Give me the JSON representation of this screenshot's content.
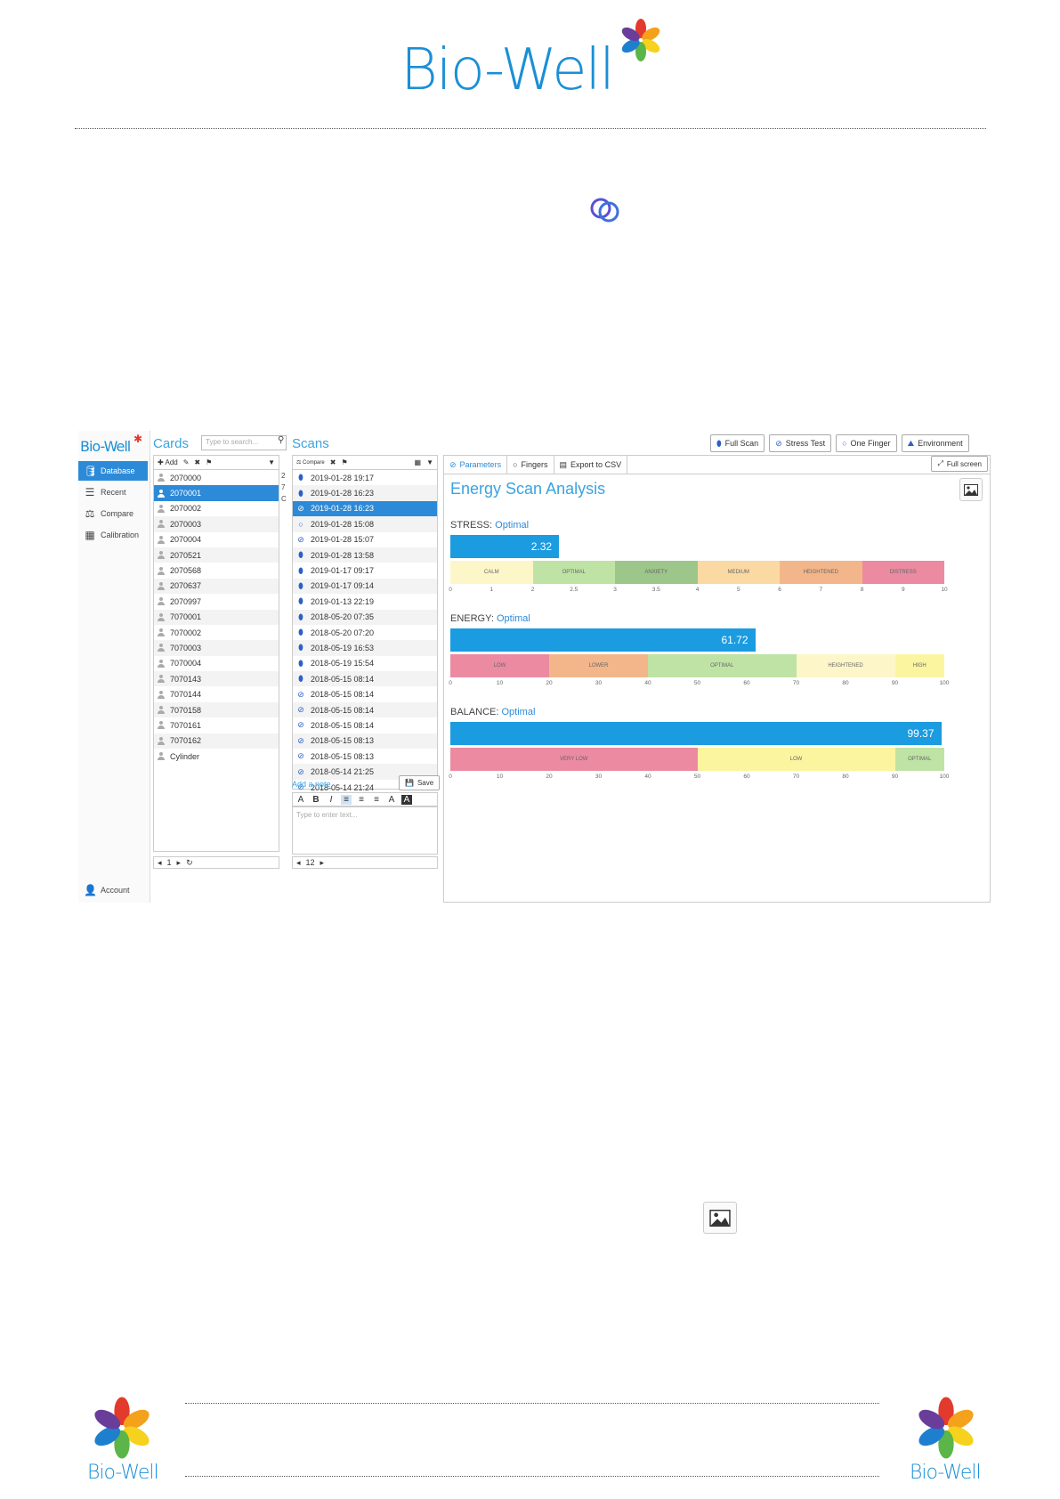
{
  "header": {
    "logo_text": "Bio-Well"
  },
  "footer": {
    "left_logo_text": "Bio-Well",
    "right_logo_text": "Bio-Well"
  },
  "app": {
    "brand": "Bio-Well",
    "nav": [
      {
        "label": "Database",
        "icon": "database-icon"
      },
      {
        "label": "Recent",
        "icon": "list-icon"
      },
      {
        "label": "Compare",
        "icon": "scales-icon"
      },
      {
        "label": "Calibration",
        "icon": "calibration-icon"
      }
    ],
    "account_label": "Account",
    "cards": {
      "title": "Cards",
      "search_placeholder": "Type to search...",
      "add_label": "Add",
      "items": [
        "2070000",
        "2070001",
        "2070002",
        "2070003",
        "2070004",
        "2070521",
        "2070568",
        "2070637",
        "2070997",
        "7070001",
        "7070002",
        "7070003",
        "7070004",
        "7070143",
        "7070144",
        "7070158",
        "7070161",
        "7070162",
        "Cylinder"
      ],
      "selected_index": 1,
      "side_numbers": [
        "2",
        "7",
        "C"
      ],
      "page": "1"
    },
    "scans": {
      "title": "Scans",
      "compare_label": "Compare",
      "items": [
        {
          "date": "2019-01-28 19:17",
          "icon": "finger"
        },
        {
          "date": "2019-01-28 16:23",
          "icon": "finger"
        },
        {
          "date": "2019-01-28 16:23",
          "icon": "stress"
        },
        {
          "date": "2019-01-28 15:08",
          "icon": "ring"
        },
        {
          "date": "2019-01-28 15:07",
          "icon": "stress"
        },
        {
          "date": "2019-01-28 13:58",
          "icon": "finger"
        },
        {
          "date": "2019-01-17 09:17",
          "icon": "finger"
        },
        {
          "date": "2019-01-17 09:14",
          "icon": "finger"
        },
        {
          "date": "2019-01-13 22:19",
          "icon": "finger"
        },
        {
          "date": "2018-05-20 07:35",
          "icon": "finger"
        },
        {
          "date": "2018-05-20 07:20",
          "icon": "finger"
        },
        {
          "date": "2018-05-19 16:53",
          "icon": "finger"
        },
        {
          "date": "2018-05-19 15:54",
          "icon": "finger"
        },
        {
          "date": "2018-05-15 08:14",
          "icon": "finger"
        },
        {
          "date": "2018-05-15 08:14",
          "icon": "stress"
        },
        {
          "date": "2018-05-15 08:14",
          "icon": "stress"
        },
        {
          "date": "2018-05-15 08:14",
          "icon": "stress"
        },
        {
          "date": "2018-05-15 08:13",
          "icon": "stress"
        },
        {
          "date": "2018-05-15 08:13",
          "icon": "stress"
        },
        {
          "date": "2018-05-14 21:25",
          "icon": "stress"
        },
        {
          "date": "2018-05-14 21:24",
          "icon": "stress"
        }
      ],
      "selected_index": 2,
      "add_note_label": "Add a note",
      "save_label": "Save",
      "note_placeholder": "Type to enter text...",
      "page": "12"
    },
    "top_buttons": [
      "Full Scan",
      "Stress Test",
      "One Finger",
      "Environment"
    ],
    "tabs": [
      "Parameters",
      "Fingers",
      "Export to CSV"
    ],
    "full_screen_label": "Full screen",
    "analysis_title": "Energy Scan Analysis",
    "metrics": [
      {
        "name": "STRESS:",
        "status": "Optimal",
        "value": 2.32,
        "value_label": "2.32",
        "zones": [
          {
            "label": "CALM",
            "color": "#fdf6c8",
            "from": 0,
            "to": 2
          },
          {
            "label": "OPTIMAL",
            "color": "#bfe3a5",
            "from": 2,
            "to": 3
          },
          {
            "label": "ANXIETY",
            "color": "#9dc68a",
            "from": 3,
            "to": 4
          },
          {
            "label": "MEDIUM",
            "color": "#fbd9a3",
            "from": 4,
            "to": 6
          },
          {
            "label": "HEIGHTENED",
            "color": "#f3b68a",
            "from": 6,
            "to": 8
          },
          {
            "label": "DISTRESS",
            "color": "#eb8aa1",
            "from": 8,
            "to": 10
          }
        ],
        "ticks": [
          "0",
          "1",
          "2",
          "2.5",
          "3",
          "3.5",
          "4",
          "5",
          "6",
          "7",
          "8",
          "9",
          "10"
        ]
      },
      {
        "name": "ENERGY:",
        "status": "Optimal",
        "value": 61.72,
        "value_label": "61.72",
        "zones": [
          {
            "label": "LOW",
            "color": "#eb8aa1",
            "from": 0,
            "to": 20
          },
          {
            "label": "LOWER",
            "color": "#f3b68a",
            "from": 20,
            "to": 40
          },
          {
            "label": "OPTIMAL",
            "color": "#bfe3a5",
            "from": 40,
            "to": 70
          },
          {
            "label": "HEIGHTENED",
            "color": "#fdf6c8",
            "from": 70,
            "to": 90
          },
          {
            "label": "HIGH",
            "color": "#fbf5a0",
            "from": 90,
            "to": 100
          }
        ],
        "ticks": [
          "0",
          "10",
          "20",
          "30",
          "40",
          "50",
          "60",
          "70",
          "80",
          "90",
          "100"
        ]
      },
      {
        "name": "BALANCE:",
        "status": "Optimal",
        "value": 99.37,
        "value_label": "99.37",
        "zones": [
          {
            "label": "VERY LOW",
            "color": "#eb8aa1",
            "from": 0,
            "to": 50
          },
          {
            "label": "LOW",
            "color": "#fbf5a0",
            "from": 50,
            "to": 90
          },
          {
            "label": "OPTIMAL",
            "color": "#bfe3a5",
            "from": 90,
            "to": 100
          }
        ],
        "ticks": [
          "0",
          "10",
          "20",
          "30",
          "40",
          "50",
          "60",
          "70",
          "80",
          "90",
          "100"
        ]
      }
    ]
  }
}
